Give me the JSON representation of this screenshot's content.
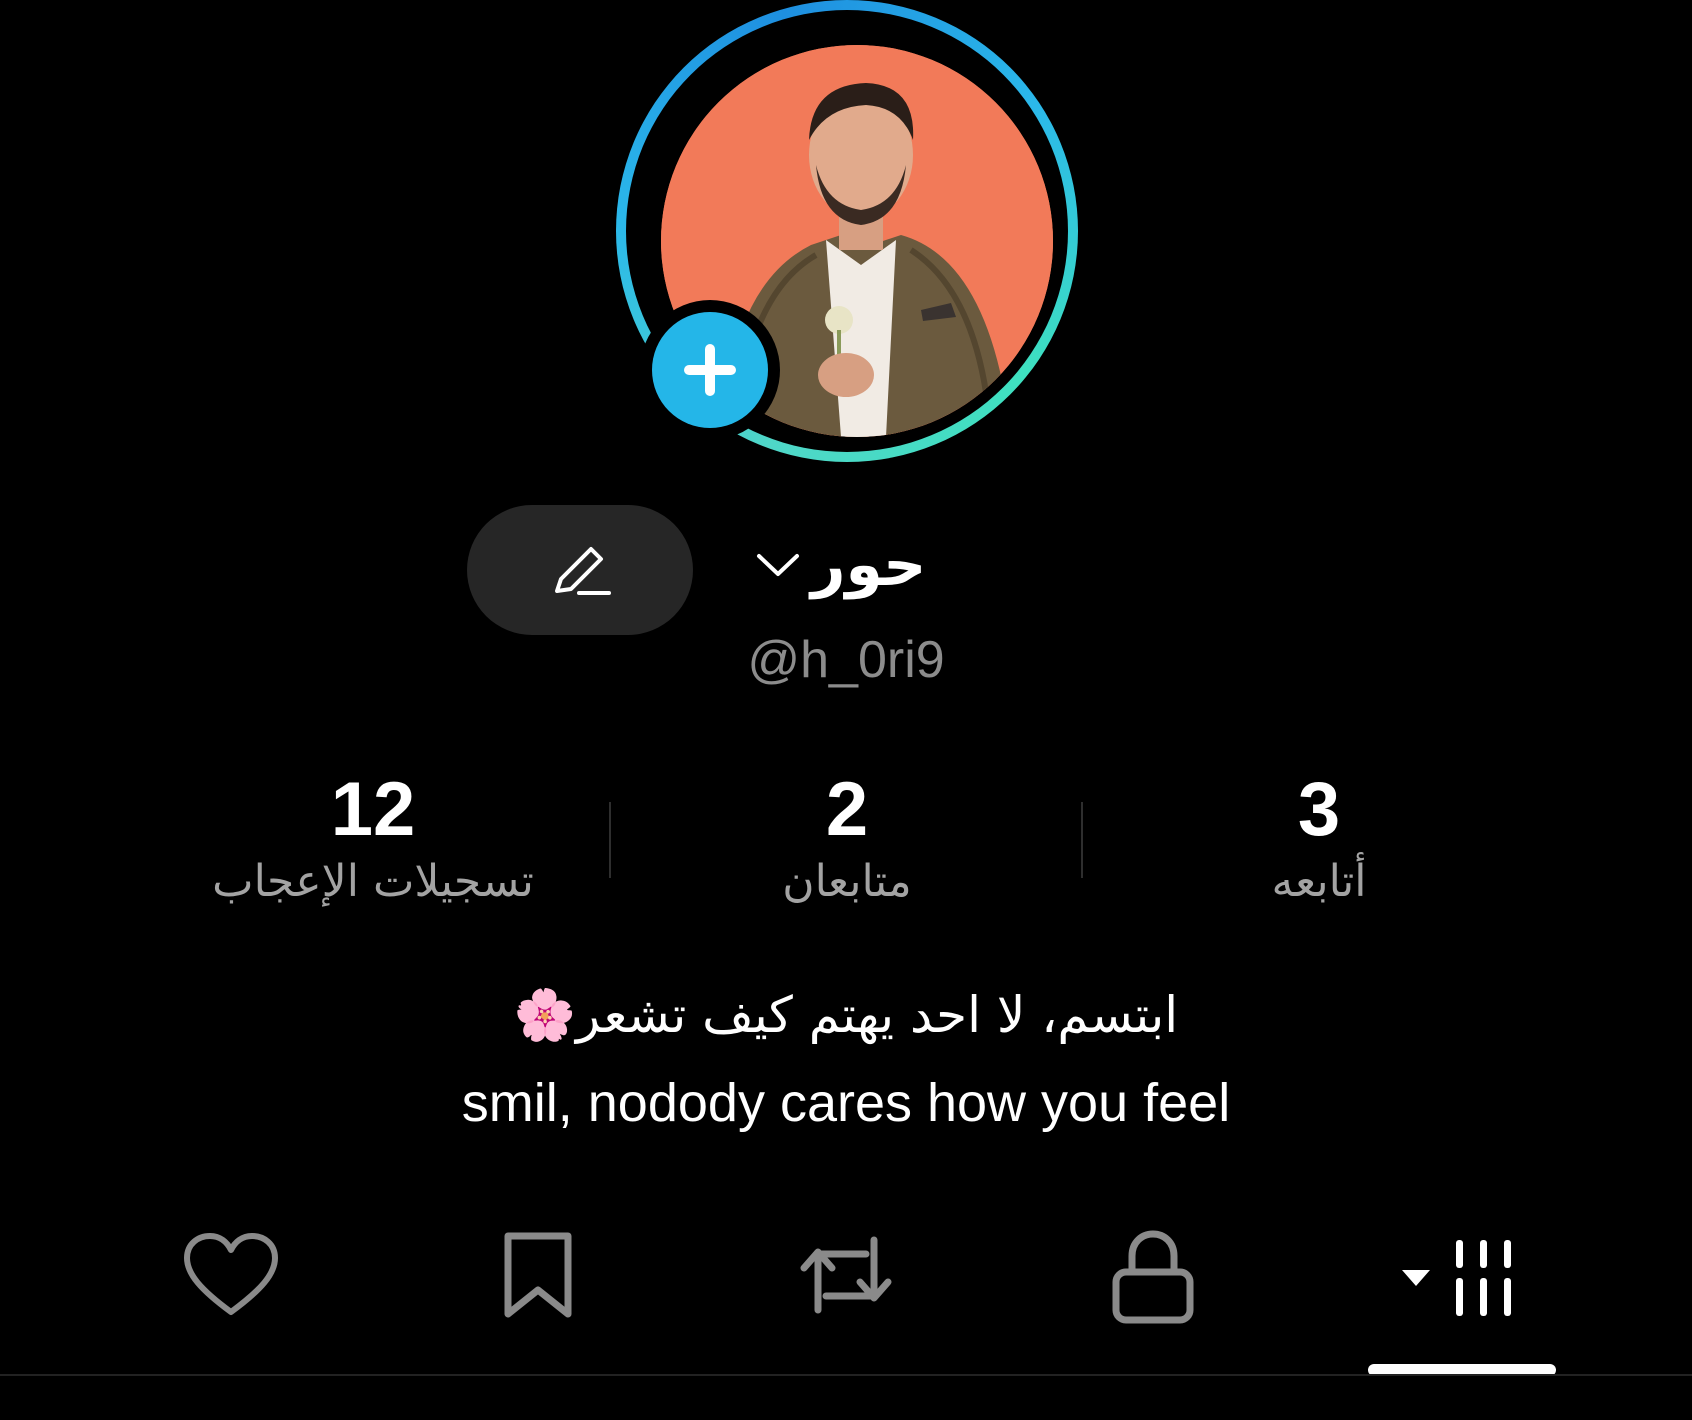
{
  "profile": {
    "display_name": "حور",
    "username": "@h_0ri9",
    "ring_colors": [
      "#2bb8ea",
      "#4fd7c8"
    ],
    "add_story_color": "#24b6e8"
  },
  "stats": [
    {
      "value": "12",
      "label": "تسجيلات الإعجاب"
    },
    {
      "value": "2",
      "label": "متابعان"
    },
    {
      "value": "3",
      "label": "أتابعه"
    }
  ],
  "bio": {
    "line1": "ابتسم، لا احد يهتم كيف تشعر🌸",
    "line2": "smil, nodody cares how you feel"
  },
  "tabs": [
    {
      "icon": "heart-icon"
    },
    {
      "icon": "bookmark-icon"
    },
    {
      "icon": "repost-icon"
    },
    {
      "icon": "lock-icon"
    },
    {
      "icon": "videos-grid-icon",
      "active": true
    }
  ]
}
